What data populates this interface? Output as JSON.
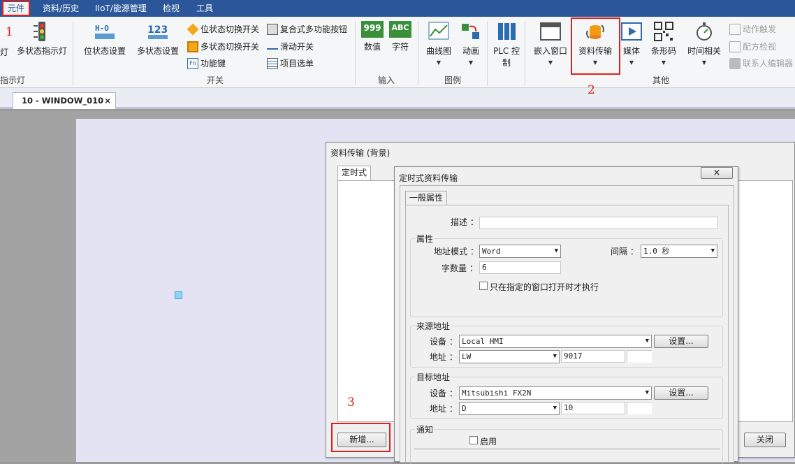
{
  "menu": {
    "items": [
      "元件",
      "资料/历史",
      "IIoT/能源管理",
      "检视",
      "工具"
    ]
  },
  "ribbon": {
    "partial_left": {
      "label": "灯",
      "group": "指示灯"
    },
    "multi_state_light": "多状态指示灯",
    "switch_group": {
      "label": "开关",
      "bit_state_setting": "位状态设置",
      "multi_state_setting": "多状态设置",
      "bit_state_toggle": "位状态切换开关",
      "multi_state_toggle": "多状态切换开关",
      "function_key": "功能键",
      "combo_button": "复合式多功能按钮",
      "slide_switch": "滑动开关",
      "item_list": "项目选单"
    },
    "input_group": {
      "label": "输入",
      "numeric": "数值",
      "char": "字符",
      "numeric_icon": "999",
      "char_icon": "ABC"
    },
    "chart_group": {
      "label": "图例",
      "trend": "曲线图",
      "animation": "动画"
    },
    "plc": {
      "label": "PLC 控制"
    },
    "other_group": {
      "label": "其他",
      "embed_window": "嵌入窗口",
      "data_transfer": "资料传输",
      "media": "媒体",
      "barcode": "条形码",
      "time_related": "时间相关"
    },
    "right_list": {
      "action_trigger": "动作触发",
      "recipe_view": "配方检视",
      "contact_editor": "联系人编辑器"
    },
    "icons": {
      "highlight": "#e02020",
      "accent": "#2b579a"
    }
  },
  "doc_tab": {
    "label": "10 - WINDOW_010",
    "close": "×"
  },
  "bg_dialog": {
    "title": "资料传输 (背景)",
    "tab": "定时式",
    "add_button": "新增...",
    "close_button": "关闭"
  },
  "fg_dialog": {
    "title": "定时式资料传输",
    "close": "×",
    "tab": "一般属性",
    "desc_label": "描述 ：",
    "desc_value": "",
    "props_title": "属性",
    "addr_mode_label": "地址模式 ：",
    "addr_mode_value": "Word",
    "interval_label": "间隔 ：",
    "interval_value": "1.0  秒",
    "word_count_label": "字数量 ：",
    "word_count_value": "6",
    "only_window_label": "只在指定的窗口打开时才执行",
    "source_title": "来源地址",
    "src_device_label": "设备 ：",
    "src_device_value": "Local HMI",
    "settings_button": "设置...",
    "src_addr_label": "地址 ：",
    "src_addr_type": "LW",
    "src_addr_value": "9017",
    "dest_title": "目标地址",
    "dst_device_label": "设备 ：",
    "dst_device_value": "Mitsubishi FX2N",
    "dst_addr_label": "地址 ：",
    "dst_addr_type": "D",
    "dst_addr_value": "10",
    "notify_title": "通知",
    "enable_label": "启用"
  },
  "annotations": {
    "n1": "1",
    "n2": "2",
    "n3": "3"
  }
}
